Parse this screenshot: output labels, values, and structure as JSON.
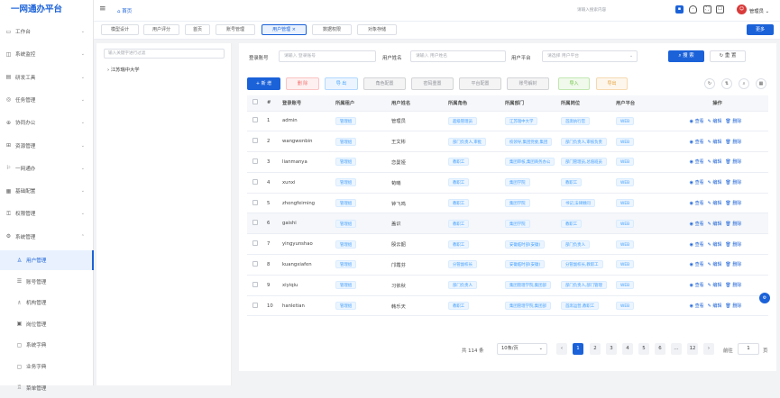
{
  "app": {
    "logo": "一网通办平台"
  },
  "sidebar": {
    "items": [
      {
        "icon": "▭",
        "label": "工作台",
        "arrow": "⌄"
      },
      {
        "icon": "◫",
        "label": "系统监控",
        "arrow": "⌄"
      },
      {
        "icon": "▤",
        "label": "研发工具",
        "arrow": "⌄"
      },
      {
        "icon": "◎",
        "label": "任务管理",
        "arrow": "⌄"
      },
      {
        "icon": "⊕",
        "label": "协同办公",
        "arrow": "⌄"
      },
      {
        "icon": "⊞",
        "label": "资源管理",
        "arrow": "⌄"
      },
      {
        "icon": "⚐",
        "label": "一网通办",
        "arrow": "⌄"
      },
      {
        "icon": "▦",
        "label": "基础配置",
        "arrow": "⌄"
      },
      {
        "icon": "⚿",
        "label": "权限管理",
        "arrow": "⌄"
      },
      {
        "icon": "⚙",
        "label": "系统管理",
        "arrow": "⌃"
      }
    ],
    "subitems": [
      {
        "icon": "♙",
        "label": "用户管理"
      },
      {
        "icon": "☰",
        "label": "账号管理"
      },
      {
        "icon": "♗",
        "label": "机构管理"
      },
      {
        "icon": "▣",
        "label": "岗位管理"
      },
      {
        "icon": "▢",
        "label": "系统字典"
      },
      {
        "icon": "▢",
        "label": "业务字典"
      },
      {
        "icon": "♖",
        "label": "菜单管理"
      }
    ]
  },
  "header": {
    "home": "首页",
    "search_placeholder": "请输入搜索内容",
    "user": "管理员"
  },
  "tabs": [
    "模型设计",
    "用户评分",
    "首页",
    "账号管理",
    "用户管理 ×",
    "数据权限",
    "对象存储"
  ],
  "tabs_more": "更多",
  "tree": {
    "search_placeholder": "输入关键字进行过滤",
    "node": "江苏瑞中大学"
  },
  "filters": {
    "account_label": "登录账号",
    "account_placeholder": "请输入 登录账号",
    "name_label": "用户姓名",
    "name_placeholder": "请输入 用户姓名",
    "platform_label": "用户平台",
    "platform_placeholder": "请选择 用户平台",
    "search": "搜 索",
    "reset": "重 置"
  },
  "toolbar": [
    "+ 新 增",
    "删 除",
    "导 出",
    "角色配置",
    "密码重置",
    "平台配置",
    "账号解封",
    "导入",
    "导出"
  ],
  "table": {
    "headers": [
      "#",
      "登录账号",
      "所属租户",
      "用户姓名",
      "所属角色",
      "所属部门",
      "所属岗位",
      "用户平台",
      "操作"
    ],
    "rows": [
      {
        "no": "1",
        "account": "admin",
        "tenant": "管理组",
        "name": "管理员",
        "role": "超级管理员",
        "dept": "江苏瑞中大学",
        "post": "首席执行官",
        "platform": "WEB"
      },
      {
        "no": "2",
        "account": "wangwenbin",
        "tenant": "管理组",
        "name": "王文彬",
        "role": "部门负责人,审批",
        "dept": "校领导,集团党委,集团",
        "post": "部门负责人,审核负责",
        "platform": "WEB"
      },
      {
        "no": "3",
        "account": "lianmanya",
        "tenant": "管理组",
        "name": "恋曼娅",
        "role": "教职工",
        "dept": "集团审核,集团商务办公",
        "post": "部门管理员,总值班员",
        "platform": "WEB"
      },
      {
        "no": "4",
        "account": "xunxi",
        "tenant": "管理组",
        "name": "荀曦",
        "role": "教职工",
        "dept": "集团学院",
        "post": "教职工",
        "platform": "WEB"
      },
      {
        "no": "5",
        "account": "zhongfeiming",
        "tenant": "管理组",
        "name": "钟飞鸣",
        "role": "教职工",
        "dept": "集团学院",
        "post": "书记,法律顾问",
        "platform": "WEB"
      },
      {
        "no": "6",
        "account": "gaishi",
        "tenant": "管理组",
        "name": "盖识",
        "role": "教职工",
        "dept": "集团学院",
        "post": "教职工",
        "platform": "WEB"
      },
      {
        "no": "7",
        "account": "yingyunshao",
        "tenant": "管理组",
        "name": "殷云韶",
        "role": "教职工",
        "dept": "安徽临时部(安徽)",
        "post": "部门负责人",
        "platform": "WEB"
      },
      {
        "no": "8",
        "account": "kuangxiafen",
        "tenant": "管理组",
        "name": "邝霞芬",
        "role": "分管副校长",
        "dept": "安徽临时部(安徽)",
        "post": "分管副校长,教职工",
        "platform": "WEB"
      },
      {
        "no": "9",
        "account": "xiyiqiu",
        "tenant": "管理组",
        "name": "习依秋",
        "role": "部门负责人",
        "dept": "集团管理学院,集团部",
        "post": "部门负责人,部门管理",
        "platform": "WEB"
      },
      {
        "no": "10",
        "account": "hanletian",
        "tenant": "管理组",
        "name": "韩乐天",
        "role": "教职工",
        "dept": "集团管理学院,集团部",
        "post": "首席运营,教职工",
        "platform": "WEB"
      }
    ],
    "actions": [
      "◉ 查看",
      "✎ 编辑",
      "🗑 删除"
    ]
  },
  "pager": {
    "total": "共 114 条",
    "size": "10条/页",
    "pages": [
      "1",
      "2",
      "3",
      "4",
      "5",
      "6",
      "…",
      "12"
    ],
    "goto": "前往",
    "page_input": "1",
    "page_unit": "页"
  }
}
